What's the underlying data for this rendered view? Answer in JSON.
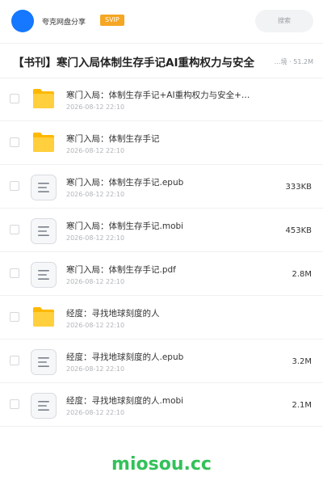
{
  "header": {
    "app_name": "夸克网盘分享",
    "badge": "SVIP",
    "search_placeholder": "搜索"
  },
  "title": {
    "text": "【书刊】寒门入局体制生存手记AI重构权力与安全",
    "meta": "…境 · 51.2M"
  },
  "colors": {
    "accent": "#1677ff",
    "svip": "#f5a623",
    "folder": "#ffc83d",
    "watermark": "#33c15a"
  },
  "files": [
    {
      "type": "folder",
      "icon": "folder-icon",
      "name": "寒门入局：体制生存手记+AI重构权力与安全+…",
      "date": "2026-08-12 22:10",
      "size": ""
    },
    {
      "type": "folder",
      "icon": "folder-icon",
      "name": "寒门入局：体制生存手记",
      "date": "2026-08-12 22:10",
      "size": ""
    },
    {
      "type": "doc",
      "icon": "document-icon",
      "name": "寒门入局：体制生存手记.epub",
      "date": "2026-08-12 22:10",
      "size": "333KB"
    },
    {
      "type": "doc",
      "icon": "document-icon",
      "name": "寒门入局：体制生存手记.mobi",
      "date": "2026-08-12 22:10",
      "size": "453KB"
    },
    {
      "type": "doc",
      "icon": "document-icon",
      "name": "寒门入局：体制生存手记.pdf",
      "date": "2026-08-12 22:10",
      "size": "2.8M"
    },
    {
      "type": "folder",
      "icon": "folder-icon",
      "name": "经度：寻找地球刻度的人",
      "date": "2026-08-12 22:10",
      "size": ""
    },
    {
      "type": "doc",
      "icon": "document-icon",
      "name": "经度：寻找地球刻度的人.epub",
      "date": "2026-08-12 22:10",
      "size": "3.2M"
    },
    {
      "type": "doc",
      "icon": "document-icon",
      "name": "经度：寻找地球刻度的人.mobi",
      "date": "2026-08-12 22:10",
      "size": "2.1M"
    }
  ],
  "watermark": "miosou.cc"
}
